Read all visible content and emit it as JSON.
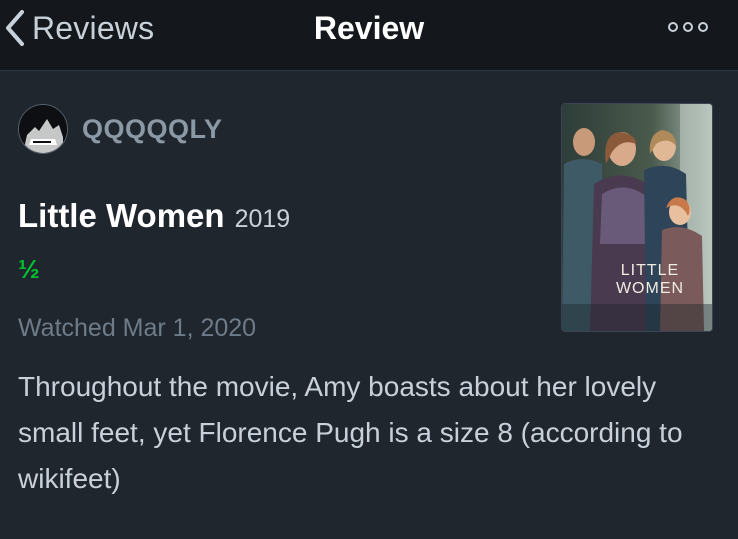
{
  "nav": {
    "back_label": "Reviews",
    "title": "Review"
  },
  "user": {
    "username": "QQQQQLY"
  },
  "film": {
    "title": "Little Women",
    "year": "2019",
    "poster_title": "LITTLE WOMEN"
  },
  "review": {
    "rating": "½",
    "watched": "Watched Mar 1, 2020",
    "text": "Throughout the movie, Amy boasts about her lovely small feet, yet Florence Pugh is a size 8 (according to wikifeet)"
  },
  "colors": {
    "background": "#20262e",
    "navbar": "#14181c",
    "rating_green": "#00c030",
    "muted_text": "#6e7b88"
  },
  "icons": {
    "back": "chevron-left-icon",
    "more": "more-options-icon"
  }
}
